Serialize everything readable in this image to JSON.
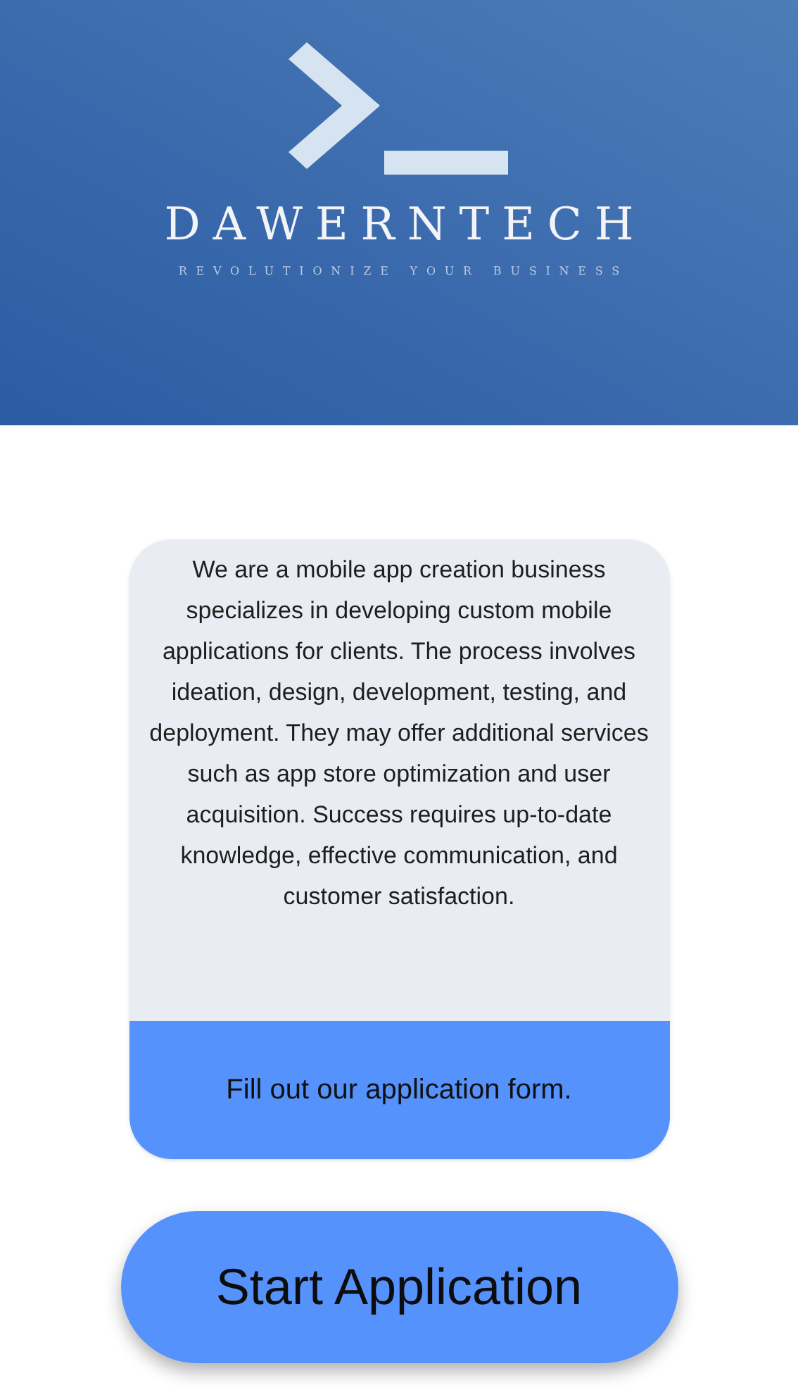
{
  "header": {
    "brand": "DAWERNTECH",
    "tagline": "REVOLUTIONIZE YOUR BUSINESS"
  },
  "card": {
    "description": "We are a mobile app creation business specializes in developing custom mobile applications for clients. The process involves ideation, design, development, testing, and deployment. They may offer additional services such as app store optimization and user acquisition. Success requires up-to-date knowledge, effective communication, and customer satisfaction.",
    "footer": "Fill out our application form."
  },
  "button": {
    "label": "Start Application"
  }
}
